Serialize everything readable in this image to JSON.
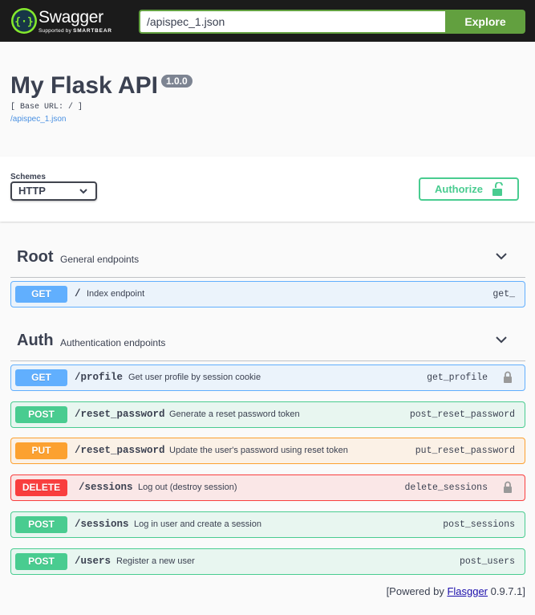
{
  "topbar": {
    "logo_title": "Swagger",
    "logo_sub_prefix": "Supported by ",
    "logo_sub_brand": "SMARTBEAR",
    "url_value": "/apispec_1.json",
    "explore_label": "Explore"
  },
  "info": {
    "title": "My Flask API",
    "version": "1.0.0",
    "base_url": "[ Base URL: / ]",
    "spec_link": "/apispec_1.json"
  },
  "schemes": {
    "label": "Schemes",
    "selected": "HTTP",
    "authorize_label": "Authorize"
  },
  "tags": [
    {
      "name": "Root",
      "description": "General endpoints",
      "operations": [
        {
          "method": "GET",
          "path": "/",
          "summary": "Index endpoint",
          "operation_id": "get_",
          "locked": false
        }
      ]
    },
    {
      "name": "Auth",
      "description": "Authentication endpoints",
      "operations": [
        {
          "method": "GET",
          "path": "/profile",
          "summary": "Get user profile by session cookie",
          "operation_id": "get_profile",
          "locked": true
        },
        {
          "method": "POST",
          "path": "/reset_password",
          "summary": "Generate a reset password token",
          "operation_id": "post_reset_password",
          "locked": false
        },
        {
          "method": "PUT",
          "path": "/reset_password",
          "summary": "Update the user's password using reset token",
          "operation_id": "put_reset_password",
          "locked": false
        },
        {
          "method": "DELETE",
          "path": "/sessions",
          "summary": "Log out (destroy session)",
          "operation_id": "delete_sessions",
          "locked": true
        },
        {
          "method": "POST",
          "path": "/sessions",
          "summary": "Log in user and create a session",
          "operation_id": "post_sessions",
          "locked": false
        },
        {
          "method": "POST",
          "path": "/users",
          "summary": "Register a new user",
          "operation_id": "post_users",
          "locked": false
        }
      ]
    }
  ],
  "footer": {
    "prefix": "[Powered by ",
    "link": "Flasgger",
    "suffix": " 0.9.7.1]"
  },
  "colors": {
    "get": "#61affe",
    "post": "#49cc90",
    "put": "#fca130",
    "delete": "#f93e3e",
    "explore": "#62a03f"
  }
}
